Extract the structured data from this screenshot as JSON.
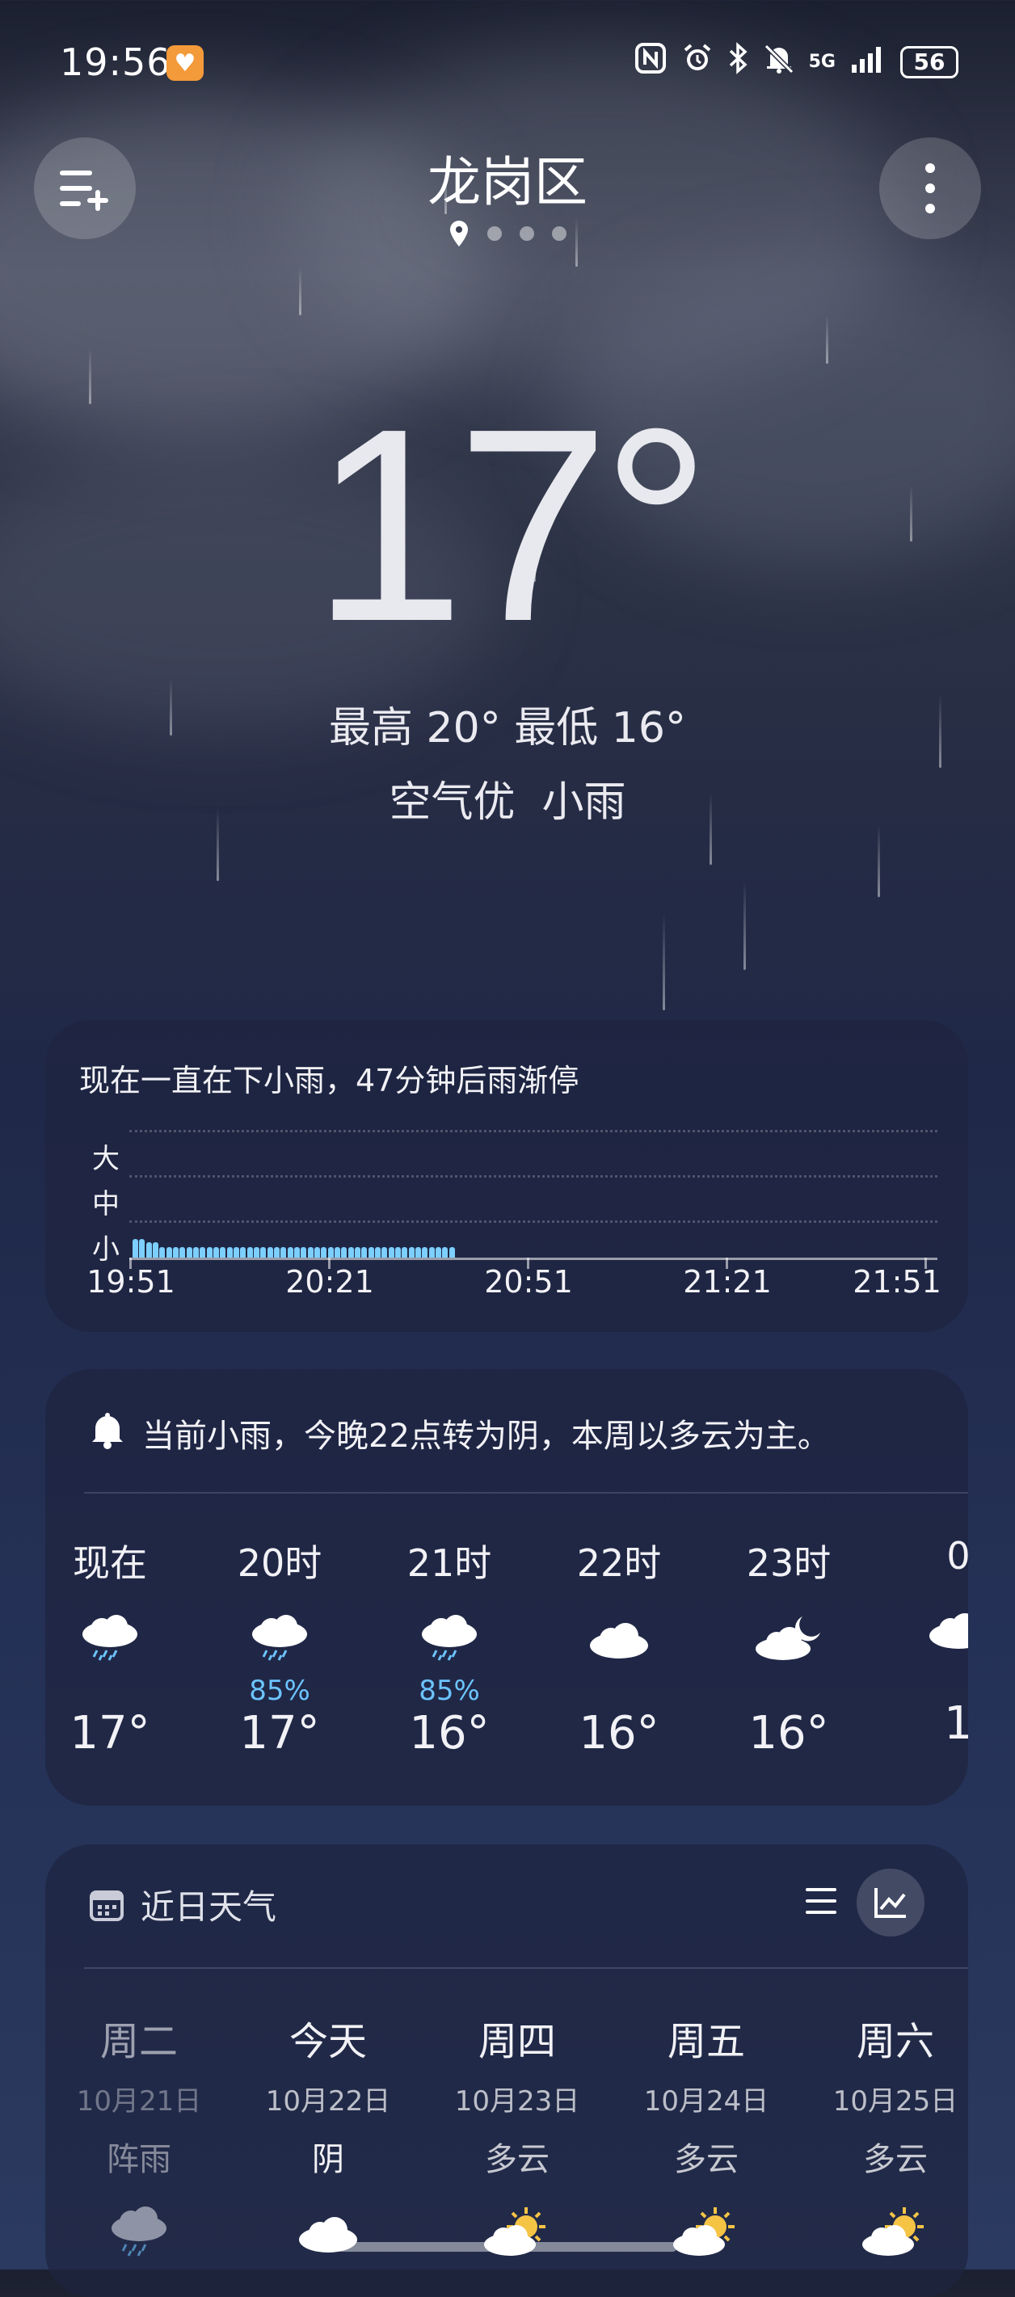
{
  "status_bar": {
    "time": "19:56",
    "network": "5G",
    "battery": "56"
  },
  "header": {
    "city": "龙岗区"
  },
  "current": {
    "temperature": "17°",
    "high_low": "最高 20° 最低 16°",
    "air_weather": "空气优  小雨"
  },
  "precipitation": {
    "title": "现在一直在下小雨，47分钟后雨渐停",
    "y_levels": [
      "大",
      "中",
      "小"
    ],
    "x_labels": [
      "19:51",
      "20:21",
      "20:51",
      "21:21",
      "21:51"
    ],
    "chart_data": {
      "type": "bar",
      "xlabel": "",
      "ylabel": "",
      "x_range": [
        "19:51",
        "21:51"
      ],
      "y_levels": [
        "小",
        "中",
        "大"
      ],
      "minutes_from_start": [
        0,
        1,
        2,
        3,
        4,
        5,
        6,
        7,
        8,
        9,
        10,
        11,
        12,
        13,
        14,
        15,
        16,
        17,
        18,
        19,
        20,
        21,
        22,
        23,
        24,
        25,
        26,
        27,
        28,
        29,
        30,
        31,
        32,
        33,
        34,
        35,
        36,
        37,
        38,
        39,
        40,
        41,
        42,
        43,
        44,
        45,
        46,
        47
      ],
      "intensity": [
        0.55,
        0.55,
        0.45,
        0.45,
        0.3,
        0.3,
        0.3,
        0.3,
        0.3,
        0.3,
        0.3,
        0.3,
        0.3,
        0.3,
        0.3,
        0.3,
        0.3,
        0.3,
        0.3,
        0.3,
        0.3,
        0.3,
        0.3,
        0.3,
        0.3,
        0.3,
        0.3,
        0.3,
        0.3,
        0.3,
        0.3,
        0.3,
        0.3,
        0.3,
        0.3,
        0.3,
        0.3,
        0.3,
        0.3,
        0.3,
        0.3,
        0.3,
        0.3,
        0.3,
        0.3,
        0.3,
        0.3,
        0.3
      ]
    }
  },
  "hourly": {
    "summary": "当前小雨，今晚22点转为阴，本周以多云为主。",
    "items": [
      {
        "label": "现在",
        "icon": "rain-cloud-icon",
        "prob": "",
        "temp": "17°"
      },
      {
        "label": "20时",
        "icon": "rain-cloud-icon",
        "prob": "85%",
        "temp": "17°"
      },
      {
        "label": "21时",
        "icon": "rain-cloud-icon",
        "prob": "85%",
        "temp": "16°"
      },
      {
        "label": "22时",
        "icon": "cloud-icon",
        "prob": "",
        "temp": "16°"
      },
      {
        "label": "23时",
        "icon": "cloud-moon-icon",
        "prob": "",
        "temp": "16°"
      },
      {
        "label": "0",
        "icon": "cloud-icon",
        "prob": "",
        "temp": "1"
      }
    ]
  },
  "daily": {
    "title": "近日天气",
    "items": [
      {
        "name": "周二",
        "date": "10月21日",
        "cond": "阵雨",
        "icon": "rain-cloud-icon"
      },
      {
        "name": "今天",
        "date": "10月22日",
        "cond": "阴",
        "icon": "cloud-icon"
      },
      {
        "name": "周四",
        "date": "10月23日",
        "cond": "多云",
        "icon": "sun-cloud-icon"
      },
      {
        "name": "周五",
        "date": "10月24日",
        "cond": "多云",
        "icon": "sun-cloud-icon"
      },
      {
        "name": "周六",
        "date": "10月25日",
        "cond": "多云",
        "icon": "sun-cloud-icon"
      }
    ]
  },
  "colors": {
    "precip_bar": "#7ccfff",
    "probability": "#6cc4ff",
    "sun": "#f6c445"
  }
}
